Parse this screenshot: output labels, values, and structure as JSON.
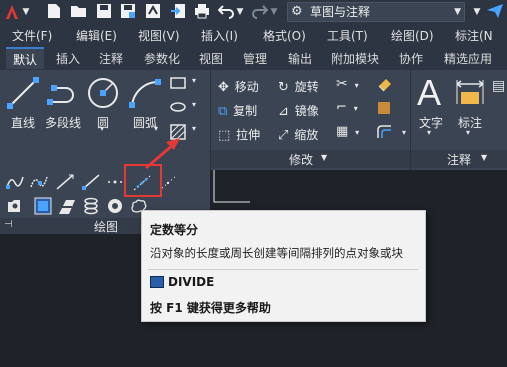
{
  "workspace": {
    "label": "草图与注释"
  },
  "menus": [
    "文件(F)",
    "编辑(E)",
    "视图(V)",
    "插入(I)",
    "格式(O)",
    "工具(T)",
    "绘图(D)",
    "标注(N"
  ],
  "tabs": [
    "默认",
    "插入",
    "注释",
    "参数化",
    "视图",
    "管理",
    "输出",
    "附加模块",
    "协作",
    "精选应用"
  ],
  "draw": {
    "line": "直线",
    "polyline": "多段线",
    "circle": "圆",
    "arc": "圆弧",
    "title": "绘图"
  },
  "modify": {
    "move": "移动",
    "rotate": "旋转",
    "copy": "复制",
    "mirror": "镜像",
    "stretch": "拉伸",
    "scale": "缩放",
    "title": "修改"
  },
  "annotation": {
    "text": "文字",
    "dimension": "标注",
    "title": "注释"
  },
  "tooltip": {
    "title": "定数等分",
    "description": "沿对象的长度或周长创建等间隔排列的点对象或块",
    "command": "DIVIDE",
    "help": "按 F1 键获得更多帮助"
  },
  "colors": {
    "accent": "#3b7ed0",
    "highlight": "#e53935",
    "ribbon": "#3b4452"
  }
}
